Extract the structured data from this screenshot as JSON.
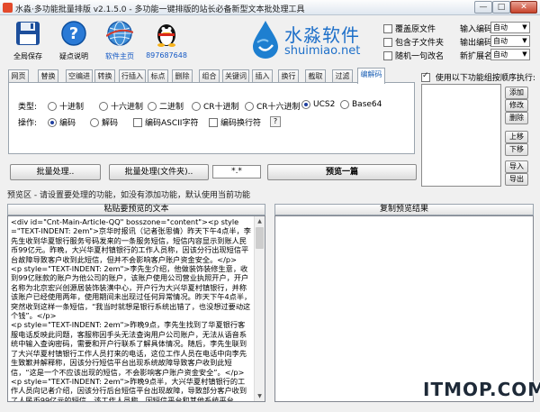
{
  "window": {
    "title": "水淼·多功能批量排版 v2.1.5.0 - 多功能一键排版的站长必备新型文本批处理工具",
    "min": "—",
    "max": "□",
    "close": "✕"
  },
  "toolbar": {
    "save_label": "全局保存",
    "help_label": "疑点说明",
    "home_label": "软件主页",
    "qq_label": "897687648"
  },
  "logo": {
    "cn": "水淼软件",
    "en": "shuimiao.net"
  },
  "options": {
    "overwrite": "覆盖原文件",
    "subfolders": "包含子文件夹",
    "random_line": "随机一句改名"
  },
  "encoding": {
    "input_label": "输入编码:",
    "input_value": "自动",
    "output_label": "输出编码:",
    "output_value": "自动",
    "ext_label": "新扩展名:",
    "ext_value": "自动"
  },
  "tabs": [
    "网页",
    "替换",
    "空编进",
    "转换",
    "行插入",
    "标点",
    "删除",
    "组合",
    "关键词",
    "插入",
    "换行",
    "截取",
    "过滤",
    "编解码"
  ],
  "panel": {
    "type_label": "类型:",
    "types": [
      "十进制",
      "十六进制",
      "二进制",
      "CR十进制",
      "CR十六进制",
      "UCS2",
      "Base64"
    ],
    "op_label": "操作:",
    "ops": [
      "编码",
      "解码"
    ],
    "ascii_label": "编码ASCII字符",
    "newline_label": "编码换行符",
    "help_btn": "?"
  },
  "chain": {
    "label": "使用以下功能组按顺序执行:",
    "add": "添加",
    "edit": "修改",
    "delete": "删除",
    "up": "上移",
    "down": "下移",
    "import": "导入",
    "export": "导出"
  },
  "actions": {
    "batch": "批量处理..",
    "batch_folder": "批量处理(文件夹)..",
    "ext_filter": "*.*",
    "preview": "预览一篇"
  },
  "hint": "预览区 - 请设置要处理的功能，如没有添加功能，默认使用当前功能",
  "paste_title": "粘贴要预览的文本",
  "result_title": "复制预览结果",
  "source_text": "<div id=\"Cnt-Main-Article-QQ\" bosszone=\"content\"><p style=\"TEXT-INDENT: 2em\">京华时报讯（记者张思倩）昨天下午4点半，李先生收到华夏银行服务号码发来的一条服务短信，短信内容显示到账人民币99亿元。昨晚，大兴华夏村镇银行的工作人员称，因该分行出现短信平台故障导致客户收到此短信，但并不会影响客户账户资金安全。</p>\n<p style=\"TEXT-INDENT: 2em\">李先生介绍，他做装饰装修生意，收到99亿账款的账户为他公司的账户，该账户使用公司营业执照开户，开户名称为北京宏兴创源居装饰装潢中心，开户行为大兴华夏村镇银行，并称该账户已经使用两年，使用期间未出现过任何异常情况。昨天下午4点半，突然收到这样一条短信，“我当时就想是银行系统出错了，也没想过要动这个钱”。</p>\n<p style=\"TEXT-INDENT: 2em\">昨晚9点，李先生找到了华夏银行客服电话反映此问题，客服称因手头无法查询用户公司账户，无法从语音系统中输入查询密码，需要和开户行联系了解具体情况。随后，李先生联到了大兴华夏村镇银行工作人员打来的电话，这位工作人员在电话中向李先生致歉并解释称，因该分行短信平台出现系统故障导致客户收到此短信，“这是一个不应该出现的短信，不会影响客户账户资金安全”。</p>\n<p style=\"TEXT-INDENT: 2em\">昨晚9点半，大兴华夏村镇银行的工作人员向记者介绍，因该分行后台短信平台出现故障，导致部分客户收到了人民币99亿元的短信。该工作人员称，因短信平台和其他系统平台",
  "watermark": "ITMOP.COM",
  "colors": {
    "accent": "#1d6fc9",
    "active_tab": "#1a5fb4",
    "close": "#c7432b"
  },
  "icons": [
    "save-icon",
    "help-icon",
    "globe-icon",
    "qq-penguin-icon",
    "water-drop-logo-icon"
  ]
}
